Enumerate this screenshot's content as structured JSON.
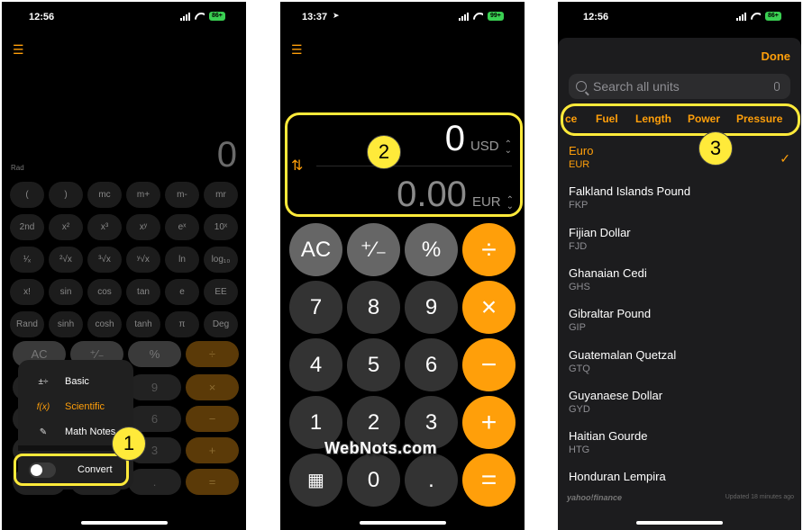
{
  "panel1": {
    "status": {
      "time": "12:56",
      "battery": "86+"
    },
    "display": "0",
    "mode_label": "Rad",
    "sci_keys": [
      "(",
      ")",
      "mc",
      "m+",
      "m-",
      "mr",
      "2nd",
      "x²",
      "x³",
      "xʸ",
      "eˣ",
      "10ˣ",
      "¹⁄ₓ",
      "²√x",
      "³√x",
      "ʸ√x",
      "ln",
      "log₁₀",
      "x!",
      "sin",
      "cos",
      "tan",
      "e",
      "EE",
      "Rand",
      "sinh",
      "cosh",
      "tanh",
      "π",
      "Deg"
    ],
    "dim_rows": [
      [
        "AC",
        "⁺⁄₋",
        "%",
        "÷"
      ],
      [
        "",
        "",
        "9",
        "×"
      ],
      [
        "",
        "",
        "6",
        "−"
      ],
      [
        "",
        "",
        "3",
        "+"
      ],
      [
        "",
        "",
        ".",
        "="
      ]
    ],
    "menu": [
      {
        "icon": "±÷",
        "label": "Basic"
      },
      {
        "icon": "f(x)",
        "label": "Scientific"
      },
      {
        "icon": "✎",
        "label": "Math Notes"
      }
    ],
    "convert_label": "Convert",
    "badge": "1"
  },
  "panel2": {
    "status": {
      "time": "13:37",
      "battery": "99+"
    },
    "top_value": "0",
    "top_unit": "USD",
    "bottom_value": "0.00",
    "bottom_unit": "EUR",
    "keys": [
      "AC",
      "⁺⁄₋",
      "%",
      "÷",
      "7",
      "8",
      "9",
      "×",
      "4",
      "5",
      "6",
      "−",
      "1",
      "2",
      "3",
      "+",
      "",
      "0",
      ".",
      "="
    ],
    "badge": "2"
  },
  "panel3": {
    "status": {
      "time": "12:56",
      "battery": "86+"
    },
    "done": "Done",
    "search_placeholder": "Search all units",
    "categories": [
      "ce",
      "Fuel",
      "Length",
      "Power",
      "Pressure"
    ],
    "units": [
      {
        "name": "Euro",
        "code": "EUR",
        "selected": true
      },
      {
        "name": "Falkland Islands Pound",
        "code": "FKP"
      },
      {
        "name": "Fijian Dollar",
        "code": "FJD"
      },
      {
        "name": "Ghanaian Cedi",
        "code": "GHS"
      },
      {
        "name": "Gibraltar Pound",
        "code": "GIP"
      },
      {
        "name": "Guatemalan Quetzal",
        "code": "GTQ"
      },
      {
        "name": "Guyanaese Dollar",
        "code": "GYD"
      },
      {
        "name": "Haitian Gourde",
        "code": "HTG"
      },
      {
        "name": "Honduran Lempira",
        "code": ""
      }
    ],
    "footer_brand": "yahoo!finance",
    "updated": "Updated 18 minutes ago",
    "badge": "3"
  },
  "watermark": "WebNots.com",
  "colors": {
    "accent": "#ff9f0a",
    "highlight": "#ffea3a",
    "background": "#000000"
  }
}
